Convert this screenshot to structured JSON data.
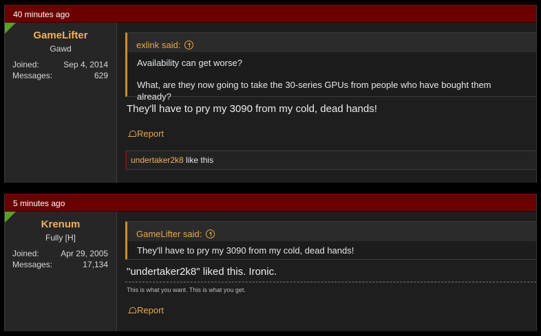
{
  "posts": [
    {
      "timestamp": "40 minutes ago",
      "user": {
        "name": "GameLifter",
        "title": "Gawd",
        "joined_label": "Joined:",
        "joined": "Sep 4, 2014",
        "messages_label": "Messages:",
        "messages": "629"
      },
      "quote": {
        "author": "exlink said:",
        "lines": [
          "Availability can get worse?",
          "What, are they now going to take the 30-series GPUs from people who have bought them already?"
        ]
      },
      "message": "They'll have to pry my 3090 from my cold, dead hands!",
      "report_label": "Report",
      "likes": {
        "user": "undertaker2k8",
        "text": " like this"
      }
    },
    {
      "timestamp": "5 minutes ago",
      "user": {
        "name": "Krenum",
        "title": "Fully [H]",
        "joined_label": "Joined:",
        "joined": "Apr 29, 2005",
        "messages_label": "Messages:",
        "messages": "17,134"
      },
      "quote": {
        "author": "GameLifter said:",
        "lines": [
          "They'll have to pry my 3090 from my cold, dead hands!"
        ]
      },
      "message": "\"undertaker2k8\" liked this. Ironic.",
      "signature": "This is what you want. This is what you get.",
      "report_label": "Report"
    }
  ],
  "icons": {
    "quote_jump": "arrow-up-circle-icon",
    "report": "bell-icon",
    "user_corner": "green-corner-icon"
  },
  "colors": {
    "header": "#6a0000",
    "username": "#f0b15a",
    "accent": "#e8a84c",
    "corner": "#5aa02c"
  }
}
